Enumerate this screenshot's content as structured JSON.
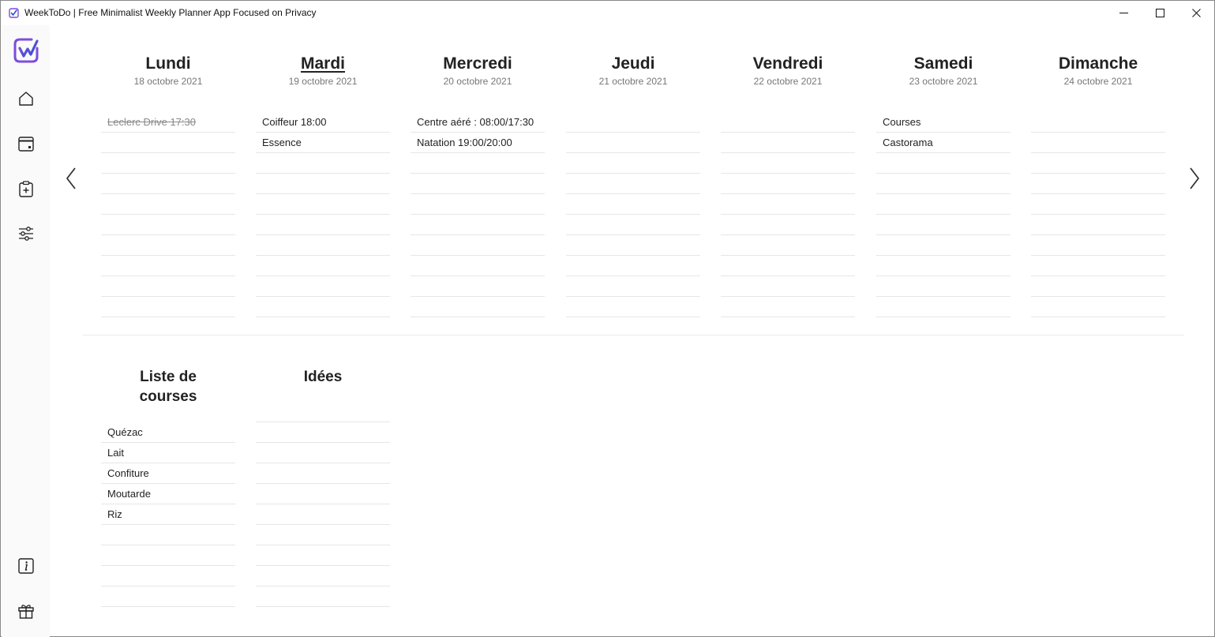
{
  "window": {
    "title": "WeekToDo | Free Minimalist Weekly Planner App Focused on Privacy"
  },
  "colors": {
    "accent_purple": "#7c4ddb",
    "accent_blue": "#2a4fd8",
    "row_line": "#e6e6e6",
    "done_text": "#8a8a8a"
  },
  "sidebar": {
    "logo": "weektodo-logo-icon",
    "items": [
      {
        "icon": "home-icon"
      },
      {
        "icon": "calendar-icon"
      },
      {
        "icon": "clipboard-add-icon"
      },
      {
        "icon": "settings-sliders-icon"
      },
      {
        "icon": "info-icon"
      },
      {
        "icon": "gift-icon"
      }
    ]
  },
  "navigation": {
    "prev_icon": "chevron-left-icon",
    "next_icon": "chevron-right-icon"
  },
  "days": [
    {
      "name": "Lundi",
      "date": "18 octobre 2021",
      "today": false,
      "tasks": [
        {
          "text": "Leclerc Drive 17:30",
          "done": true
        },
        {
          "text": "",
          "done": false
        },
        {
          "text": "",
          "done": false
        },
        {
          "text": "",
          "done": false
        },
        {
          "text": "",
          "done": false
        },
        {
          "text": "",
          "done": false
        },
        {
          "text": "",
          "done": false
        },
        {
          "text": "",
          "done": false
        },
        {
          "text": "",
          "done": false
        },
        {
          "text": "",
          "done": false
        }
      ]
    },
    {
      "name": "Mardi",
      "date": "19 octobre 2021",
      "today": true,
      "tasks": [
        {
          "text": "Coiffeur 18:00",
          "done": false
        },
        {
          "text": "Essence",
          "done": false
        },
        {
          "text": "",
          "done": false
        },
        {
          "text": "",
          "done": false
        },
        {
          "text": "",
          "done": false
        },
        {
          "text": "",
          "done": false
        },
        {
          "text": "",
          "done": false
        },
        {
          "text": "",
          "done": false
        },
        {
          "text": "",
          "done": false
        },
        {
          "text": "",
          "done": false
        }
      ]
    },
    {
      "name": "Mercredi",
      "date": "20 octobre 2021",
      "today": false,
      "tasks": [
        {
          "text": "Centre aéré : 08:00/17:30",
          "done": false
        },
        {
          "text": "Natation 19:00/20:00",
          "done": false
        },
        {
          "text": "",
          "done": false
        },
        {
          "text": "",
          "done": false
        },
        {
          "text": "",
          "done": false
        },
        {
          "text": "",
          "done": false
        },
        {
          "text": "",
          "done": false
        },
        {
          "text": "",
          "done": false
        },
        {
          "text": "",
          "done": false
        },
        {
          "text": "",
          "done": false
        }
      ]
    },
    {
      "name": "Jeudi",
      "date": "21 octobre 2021",
      "today": false,
      "tasks": [
        {
          "text": "",
          "done": false
        },
        {
          "text": "",
          "done": false
        },
        {
          "text": "",
          "done": false
        },
        {
          "text": "",
          "done": false
        },
        {
          "text": "",
          "done": false
        },
        {
          "text": "",
          "done": false
        },
        {
          "text": "",
          "done": false
        },
        {
          "text": "",
          "done": false
        },
        {
          "text": "",
          "done": false
        },
        {
          "text": "",
          "done": false
        }
      ]
    },
    {
      "name": "Vendredi",
      "date": "22 octobre 2021",
      "today": false,
      "tasks": [
        {
          "text": "",
          "done": false
        },
        {
          "text": "",
          "done": false
        },
        {
          "text": "",
          "done": false
        },
        {
          "text": "",
          "done": false
        },
        {
          "text": "",
          "done": false
        },
        {
          "text": "",
          "done": false
        },
        {
          "text": "",
          "done": false
        },
        {
          "text": "",
          "done": false
        },
        {
          "text": "",
          "done": false
        },
        {
          "text": "",
          "done": false
        }
      ]
    },
    {
      "name": "Samedi",
      "date": "23 octobre 2021",
      "today": false,
      "tasks": [
        {
          "text": "Courses",
          "done": false
        },
        {
          "text": "Castorama",
          "done": false
        },
        {
          "text": "",
          "done": false
        },
        {
          "text": "",
          "done": false
        },
        {
          "text": "",
          "done": false
        },
        {
          "text": "",
          "done": false
        },
        {
          "text": "",
          "done": false
        },
        {
          "text": "",
          "done": false
        },
        {
          "text": "",
          "done": false
        },
        {
          "text": "",
          "done": false
        }
      ]
    },
    {
      "name": "Dimanche",
      "date": "24 octobre 2021",
      "today": false,
      "tasks": [
        {
          "text": "",
          "done": false
        },
        {
          "text": "",
          "done": false
        },
        {
          "text": "",
          "done": false
        },
        {
          "text": "",
          "done": false
        },
        {
          "text": "",
          "done": false
        },
        {
          "text": "",
          "done": false
        },
        {
          "text": "",
          "done": false
        },
        {
          "text": "",
          "done": false
        },
        {
          "text": "",
          "done": false
        },
        {
          "text": "",
          "done": false
        }
      ]
    }
  ],
  "custom_lists": [
    {
      "title": "Liste de courses",
      "tasks": [
        {
          "text": "Quézac",
          "done": false
        },
        {
          "text": "Lait",
          "done": false
        },
        {
          "text": "Confiture",
          "done": false
        },
        {
          "text": "Moutarde",
          "done": false
        },
        {
          "text": "Riz",
          "done": false
        },
        {
          "text": "",
          "done": false
        },
        {
          "text": "",
          "done": false
        },
        {
          "text": "",
          "done": false
        },
        {
          "text": "",
          "done": false
        }
      ]
    },
    {
      "title": "Idées",
      "tasks": [
        {
          "text": "",
          "done": false
        },
        {
          "text": "",
          "done": false
        },
        {
          "text": "",
          "done": false
        },
        {
          "text": "",
          "done": false
        },
        {
          "text": "",
          "done": false
        },
        {
          "text": "",
          "done": false
        },
        {
          "text": "",
          "done": false
        },
        {
          "text": "",
          "done": false
        },
        {
          "text": "",
          "done": false
        },
        {
          "text": "",
          "done": false
        }
      ]
    }
  ]
}
